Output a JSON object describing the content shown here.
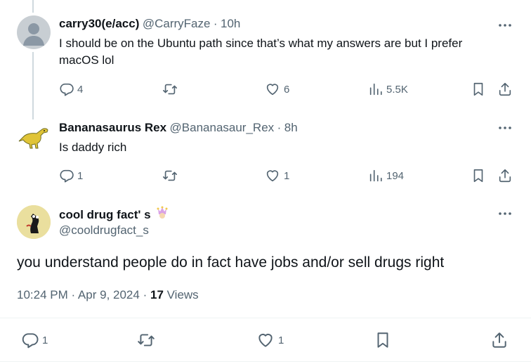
{
  "replies": [
    {
      "name": "carry30(e/acc)",
      "handle": "@CarryFaze",
      "time": "10h",
      "text": "I should be on the Ubuntu path since that’s what my answers are but I prefer macOS lol",
      "replies": "4",
      "retweets": "",
      "likes": "6",
      "views": "5.5K"
    },
    {
      "name": "Bananasaurus Rex",
      "handle": "@Bananasaur_Rex",
      "time": "8h",
      "text": "Is daddy rich",
      "replies": "1",
      "retweets": "",
      "likes": "1",
      "views": "194"
    }
  ],
  "main": {
    "name": "cool drug fact' s",
    "handle": "@cooldrugfact_s",
    "text": "you understand people do in fact have jobs and/or sell drugs right",
    "timestamp": "10:24 PM · Apr 9, 2024",
    "separator": "·",
    "views_count": "17",
    "views_label": "Views",
    "replies": "1",
    "likes": "1"
  },
  "colors": {
    "text": "#0f1419",
    "secondary": "#536471",
    "line": "#cfd9de",
    "divider": "#eff3f4"
  }
}
